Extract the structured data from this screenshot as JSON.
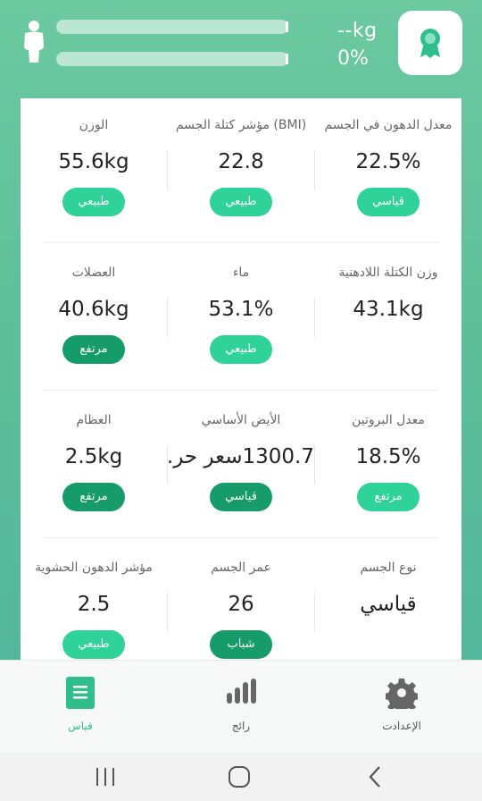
{
  "header": {
    "weight": "--kg",
    "percent": "0%"
  },
  "metrics": [
    [
      {
        "label": "الوزن",
        "value": "55.6kg",
        "tag": "طبيعي",
        "tag_color": "#2fd39a"
      },
      {
        "label": "مؤشر كتلة الجسم (BMI)",
        "value": "22.8",
        "tag": "طبيعي",
        "tag_color": "#2fd39a"
      },
      {
        "label": "معدل الدهون في الجسم",
        "value": "22.5%",
        "tag": "قياسي",
        "tag_color": "#2fd39a"
      }
    ],
    [
      {
        "label": "العضلات",
        "value": "40.6kg",
        "tag": "مرتفع",
        "tag_color": "#169c6b"
      },
      {
        "label": "ماء",
        "value": "53.1%",
        "tag": "طبيعي",
        "tag_color": "#2fd39a"
      },
      {
        "label": "وزن الكتلة اللادهنية",
        "value": "43.1kg",
        "tag": "",
        "tag_color": ""
      }
    ],
    [
      {
        "label": "العظام",
        "value": "2.5kg",
        "tag": "مرتفع",
        "tag_color": "#169c6b"
      },
      {
        "label": "الأيض الأساسي",
        "value": "1300.7سعر حر...",
        "tag": "قياسي",
        "tag_color": "#169c6b"
      },
      {
        "label": "معدل البروتين",
        "value": "18.5%",
        "tag": "مرتفع",
        "tag_color": "#2fd39a"
      }
    ],
    [
      {
        "label": "مؤشر الدهون الحشوية",
        "value": "2.5",
        "tag": "طبيعي",
        "tag_color": "#2fd39a"
      },
      {
        "label": "عمر الجسم",
        "value": "26",
        "tag": "شباب",
        "tag_color": "#169c6b"
      },
      {
        "label": "نوع الجسم",
        "value": "قياسي",
        "tag": "",
        "tag_color": ""
      }
    ]
  ],
  "nav": {
    "measure": "قياس",
    "trend": "رائج",
    "settings": "الإعدادت"
  },
  "colors": {
    "accent": "#2fbf8c",
    "tag_light": "#2fd39a",
    "tag_dark": "#169c6b"
  }
}
